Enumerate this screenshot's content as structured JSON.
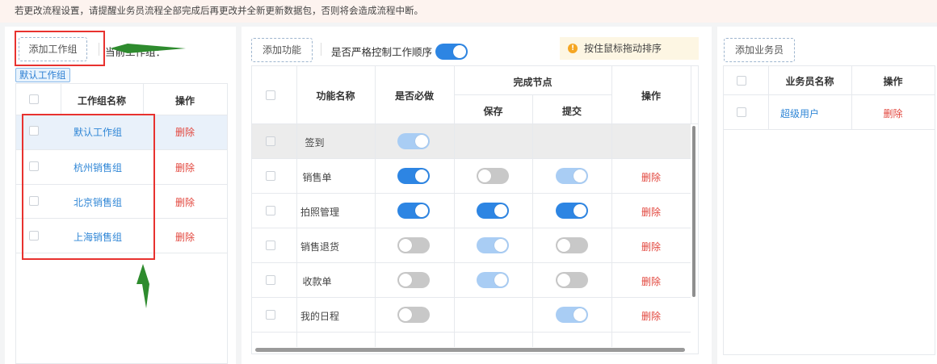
{
  "banner": {
    "text": "若更改流程设置，请提醒业务员流程全部完成后再更改并全新更新数据包，否则将会造成流程中断。"
  },
  "left": {
    "add_group_label": "添加工作组",
    "current_group_label": "当前工作组：",
    "default_tag": "默认工作组",
    "headers": {
      "name": "工作组名称",
      "action": "操作"
    },
    "rows": [
      {
        "name": "默认工作组",
        "action": "删除"
      },
      {
        "name": "杭州销售组",
        "action": "删除"
      },
      {
        "name": "北京销售组",
        "action": "删除"
      },
      {
        "name": "上海销售组",
        "action": "删除"
      }
    ]
  },
  "middle": {
    "add_function_label": "添加功能",
    "strict_order_label": "是否严格控制工作顺序",
    "strict_order_on": true,
    "sort_hint": "按住鼠标拖动排序",
    "headers": {
      "name": "功能名称",
      "required": "是否必做",
      "complete_node": "完成节点",
      "save": "保存",
      "submit": "提交",
      "action": "操作"
    },
    "rows": [
      {
        "name": "签到",
        "required": "disabled",
        "save": null,
        "submit": null,
        "action": ""
      },
      {
        "name": "销售单",
        "required": "on",
        "save": "off",
        "submit": "disabled",
        "action": "删除"
      },
      {
        "name": "拍照管理",
        "required": "on",
        "save": "on",
        "submit": "on",
        "action": "删除"
      },
      {
        "name": "销售退货",
        "required": "off",
        "save": "disabled",
        "submit": "off",
        "action": "删除"
      },
      {
        "name": "收款单",
        "required": "off",
        "save": "disabled",
        "submit": "off",
        "action": "删除"
      },
      {
        "name": "我的日程",
        "required": "off",
        "save": null,
        "submit": "disabled",
        "action": "删除"
      }
    ]
  },
  "right": {
    "add_staff_label": "添加业务员",
    "headers": {
      "name": "业务员名称",
      "action": "操作"
    },
    "rows": [
      {
        "name": "超级用户",
        "action": "删除"
      }
    ]
  },
  "colors": {
    "accent": "#2d85e3",
    "danger": "#e2463d",
    "annotation": "#2e8b2e",
    "highlight": "#e8322f"
  }
}
